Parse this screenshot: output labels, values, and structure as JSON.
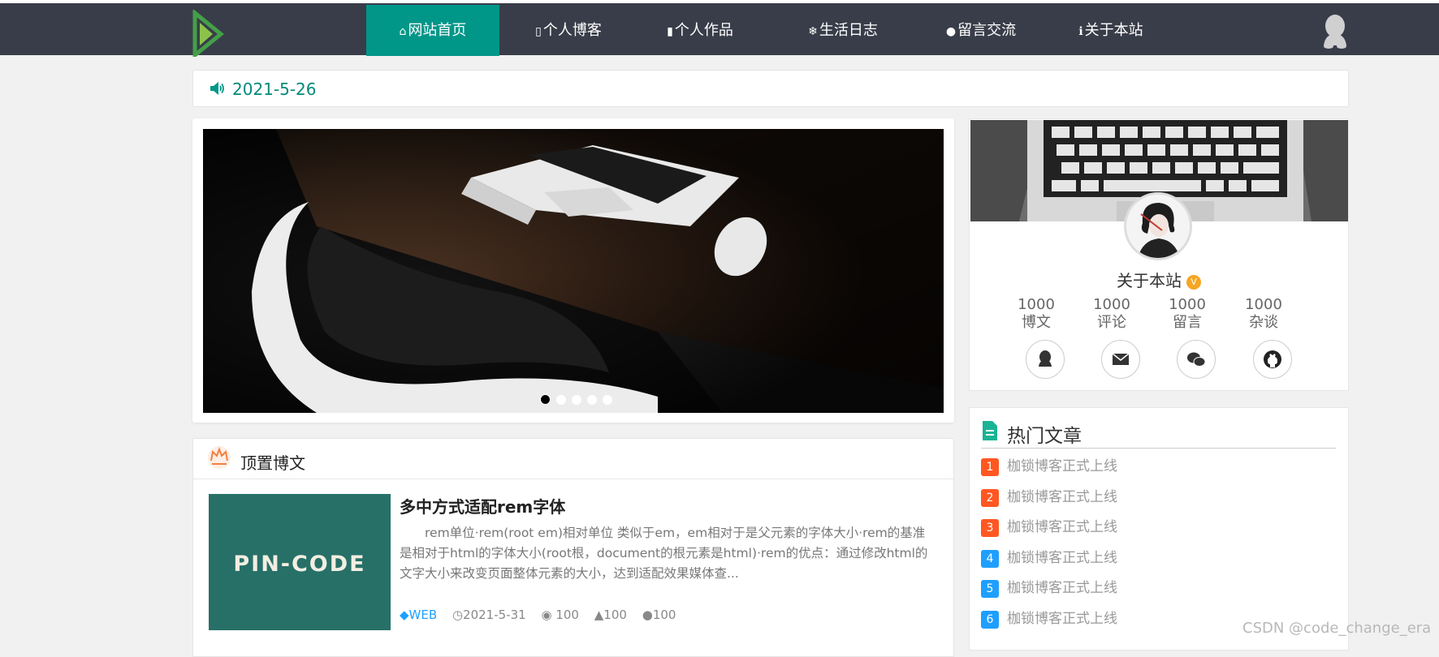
{
  "nav": {
    "items": [
      {
        "label": "网站首页",
        "icon": "home-icon",
        "active": true
      },
      {
        "label": "个人博客",
        "icon": "book-icon"
      },
      {
        "label": "个人作品",
        "icon": "file-icon"
      },
      {
        "label": "生活日志",
        "icon": "snowflake-icon"
      },
      {
        "label": "留言交流",
        "icon": "chat-icon"
      },
      {
        "label": "关于本站",
        "icon": "info-icon"
      }
    ]
  },
  "notice": {
    "text": "2021-5-26",
    "icon": "volume-icon"
  },
  "carousel": {
    "slide_count": 5,
    "active_index": 0
  },
  "profile": {
    "name": "关于本站",
    "badge": "V",
    "stats": [
      {
        "value": "1000",
        "label": "博文"
      },
      {
        "value": "1000",
        "label": "评论"
      },
      {
        "value": "1000",
        "label": "留言"
      },
      {
        "value": "1000",
        "label": "杂谈"
      }
    ],
    "socials": [
      "qq-icon",
      "mail-icon",
      "wechat-icon",
      "github-icon"
    ]
  },
  "hot": {
    "title": "热门文章",
    "items": [
      {
        "rank": "1",
        "title": "枷锁博客正式上线",
        "color": "#ff5722"
      },
      {
        "rank": "2",
        "title": "枷锁博客正式上线",
        "color": "#ff5722"
      },
      {
        "rank": "3",
        "title": "枷锁博客正式上线",
        "color": "#ff5722"
      },
      {
        "rank": "4",
        "title": "枷锁博客正式上线",
        "color": "#1e9fff"
      },
      {
        "rank": "5",
        "title": "枷锁博客正式上线",
        "color": "#1e9fff"
      },
      {
        "rank": "6",
        "title": "枷锁博客正式上线",
        "color": "#1e9fff"
      }
    ]
  },
  "pinned": {
    "title": "顶置博文",
    "post": {
      "title": "多中方式适配rem字体",
      "image_text": "PIN-CODE",
      "excerpt": "　　rem单位·rem(root em)相对单位 类似于em，em相对于是父元素的字体大小·rem的基准是相对于html的字体大小(root根，document的根元素是html)·rem的优点：通过修改html的文字大小来改变页面整体元素的大小，达到适配效果媒体查...",
      "tag": "WEB",
      "date": "2021-5-31",
      "views": "100",
      "likes": "100",
      "comments": "100"
    }
  },
  "watermark": "CSDN @code_change_era",
  "colors": {
    "nav_bg": "#393d49",
    "accent": "#009688",
    "hot_rank_red": "#ff5722",
    "hot_rank_blue": "#1e9fff"
  }
}
